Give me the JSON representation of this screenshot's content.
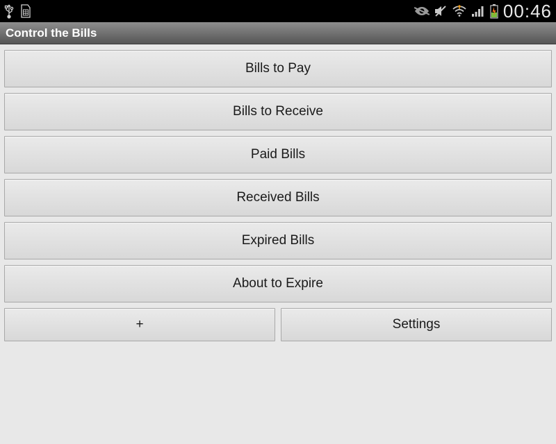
{
  "status": {
    "clock": "00:46"
  },
  "title": "Control the Bills",
  "menu": {
    "bills_to_pay": "Bills to Pay",
    "bills_to_receive": "Bills to Receive",
    "paid_bills": "Paid Bills",
    "received_bills": "Received Bills",
    "expired_bills": "Expired Bills",
    "about_to_expire": "About to Expire",
    "add": "+",
    "settings": "Settings"
  }
}
